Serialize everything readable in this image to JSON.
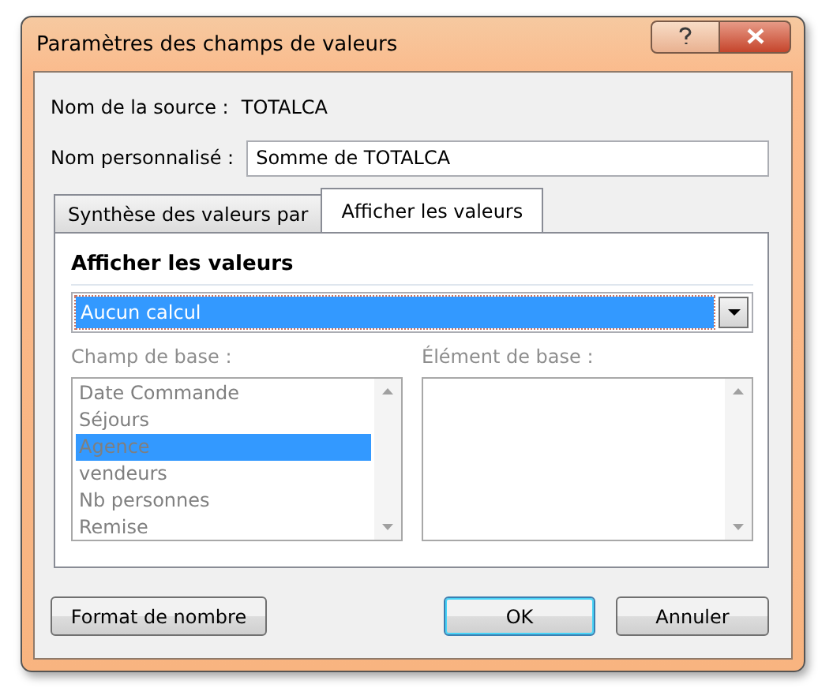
{
  "window": {
    "title": "Paramètres des champs de valeurs"
  },
  "source": {
    "label": "Nom de la source :",
    "value": "TOTALCA"
  },
  "custom_name": {
    "label": "Nom personnalisé :",
    "value": "Somme de TOTALCA"
  },
  "tabs": [
    {
      "label": "Synthèse des valeurs par",
      "selected": false
    },
    {
      "label": "Afficher les valeurs",
      "selected": true
    }
  ],
  "panel": {
    "heading": "Afficher les valeurs",
    "calculation": {
      "value": "Aucun calcul"
    },
    "base_field": {
      "label": "Champ de base :",
      "disabled": true,
      "items": [
        {
          "label": "Date Commande",
          "selected": false
        },
        {
          "label": "Séjours",
          "selected": false
        },
        {
          "label": "Agence",
          "selected": true
        },
        {
          "label": "vendeurs",
          "selected": false
        },
        {
          "label": "Nb personnes",
          "selected": false
        },
        {
          "label": "Remise",
          "selected": false
        }
      ]
    },
    "base_item": {
      "label": "Élément de base :",
      "disabled": true
    }
  },
  "buttons": [
    {
      "label": "Format de nombre",
      "default": false
    },
    {
      "label": "OK",
      "default": true
    },
    {
      "label": "Annuler",
      "default": false
    }
  ]
}
